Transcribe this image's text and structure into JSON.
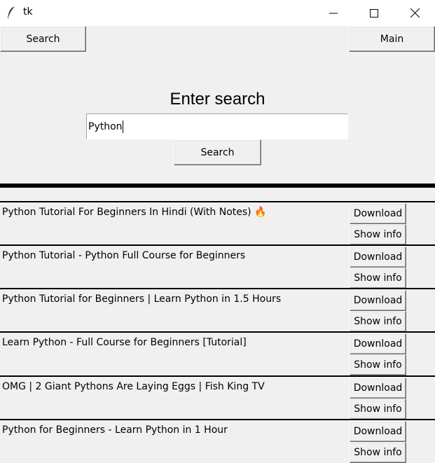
{
  "window": {
    "title": "tk"
  },
  "nav": {
    "search_tab": "Search",
    "main_tab": "Main"
  },
  "search": {
    "heading": "Enter search",
    "value": "Python",
    "button": "Search"
  },
  "results": [
    {
      "title": "Python Tutorial For Beginners In Hindi (With Notes) 🔥",
      "download": "Download",
      "info": "Show info"
    },
    {
      "title": "Python Tutorial - Python Full Course for Beginners",
      "download": "Download",
      "info": "Show info"
    },
    {
      "title": "Python Tutorial for Beginners | Learn Python in 1.5 Hours",
      "download": "Download",
      "info": "Show info"
    },
    {
      "title": "Learn Python - Full Course for Beginners [Tutorial]",
      "download": "Download",
      "info": "Show info"
    },
    {
      "title": "OMG | 2 Giant Pythons Are Laying Eggs | Fish King TV",
      "download": "Download",
      "info": "Show info"
    },
    {
      "title": "Python for Beginners - Learn Python in 1 Hour",
      "download": "Download",
      "info": "Show info"
    }
  ]
}
